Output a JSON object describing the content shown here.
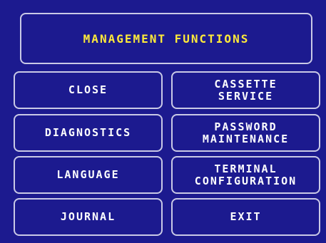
{
  "header": {
    "title": "MANAGEMENT FUNCTIONS"
  },
  "menu": {
    "left": [
      {
        "label": "CLOSE"
      },
      {
        "label": "DIAGNOSTICS"
      },
      {
        "label": "LANGUAGE"
      },
      {
        "label": "JOURNAL"
      }
    ],
    "right": [
      {
        "label": "CASSETTE\nSERVICE"
      },
      {
        "label": "PASSWORD\nMAINTENANCE"
      },
      {
        "label": "TERMINAL\nCONFIGURATION"
      },
      {
        "label": "EXIT"
      }
    ]
  },
  "colors": {
    "background": "#1c1a8f",
    "title_text": "#ffea3a",
    "button_text": "#ffffff",
    "border": "#c9c9e6"
  }
}
